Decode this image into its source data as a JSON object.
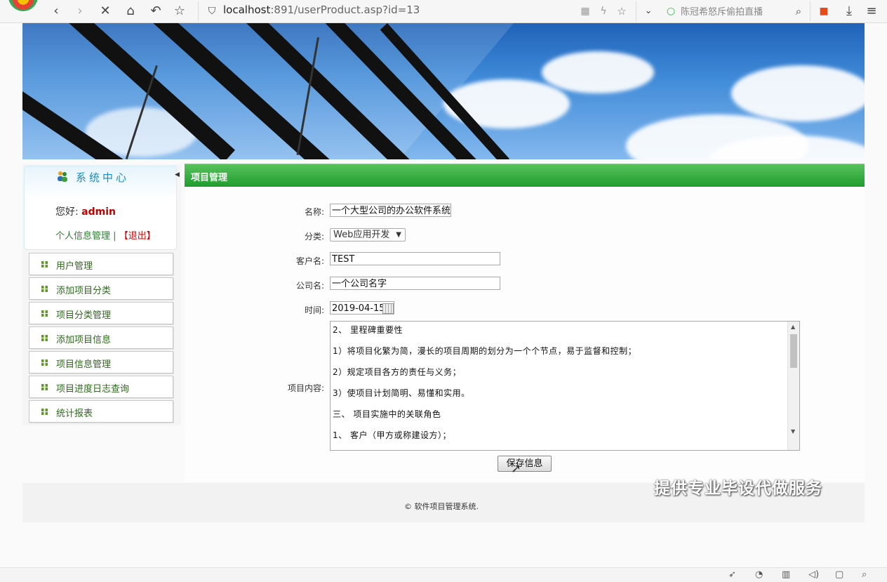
{
  "browser": {
    "url_host": "localhost",
    "url_rest": ":891/userProduct.asp?id=13",
    "search_text": "陈冠希怒斥偷拍直播"
  },
  "sidebar": {
    "title": "系统中心",
    "greeting_label": "您好:",
    "username": "admin",
    "profile_link": "个人信息管理",
    "divider": "|",
    "logout_link": "【退出】",
    "menu": [
      {
        "label": "用户管理"
      },
      {
        "label": "添加项目分类"
      },
      {
        "label": "项目分类管理"
      },
      {
        "label": "添加项目信息"
      },
      {
        "label": "项目信息管理"
      },
      {
        "label": "项目进度日志查询"
      },
      {
        "label": "统计报表"
      }
    ]
  },
  "main": {
    "header": "项目管理",
    "form": {
      "name_label": "名称:",
      "name_value": "一个大型公司的办公软件系统",
      "category_label": "分类:",
      "category_value": "Web应用开发",
      "customer_label": "客户名:",
      "customer_value": "TEST",
      "company_label": "公司名:",
      "company_value": "一个公司名字",
      "date_label": "时间:",
      "date_value": "2019-04-15",
      "content_label": "项目内容:",
      "content_lines": [
        "2、 里程碑重要性",
        "1）将项目化繁为简，漫长的项目周期的划分为一个个节点，易于监督和控制；",
        "2）规定项目各方的责任与义务；",
        "3）使项目计划简明、易懂和实用。",
        "三、 项目实施中的关联角色",
        "1、 客户（甲方或称建设方）；"
      ],
      "save_button": "保存信息"
    }
  },
  "footer": {
    "copyright": "© 软件项目管理系统."
  },
  "watermark": "提供专业毕设代做服务"
}
